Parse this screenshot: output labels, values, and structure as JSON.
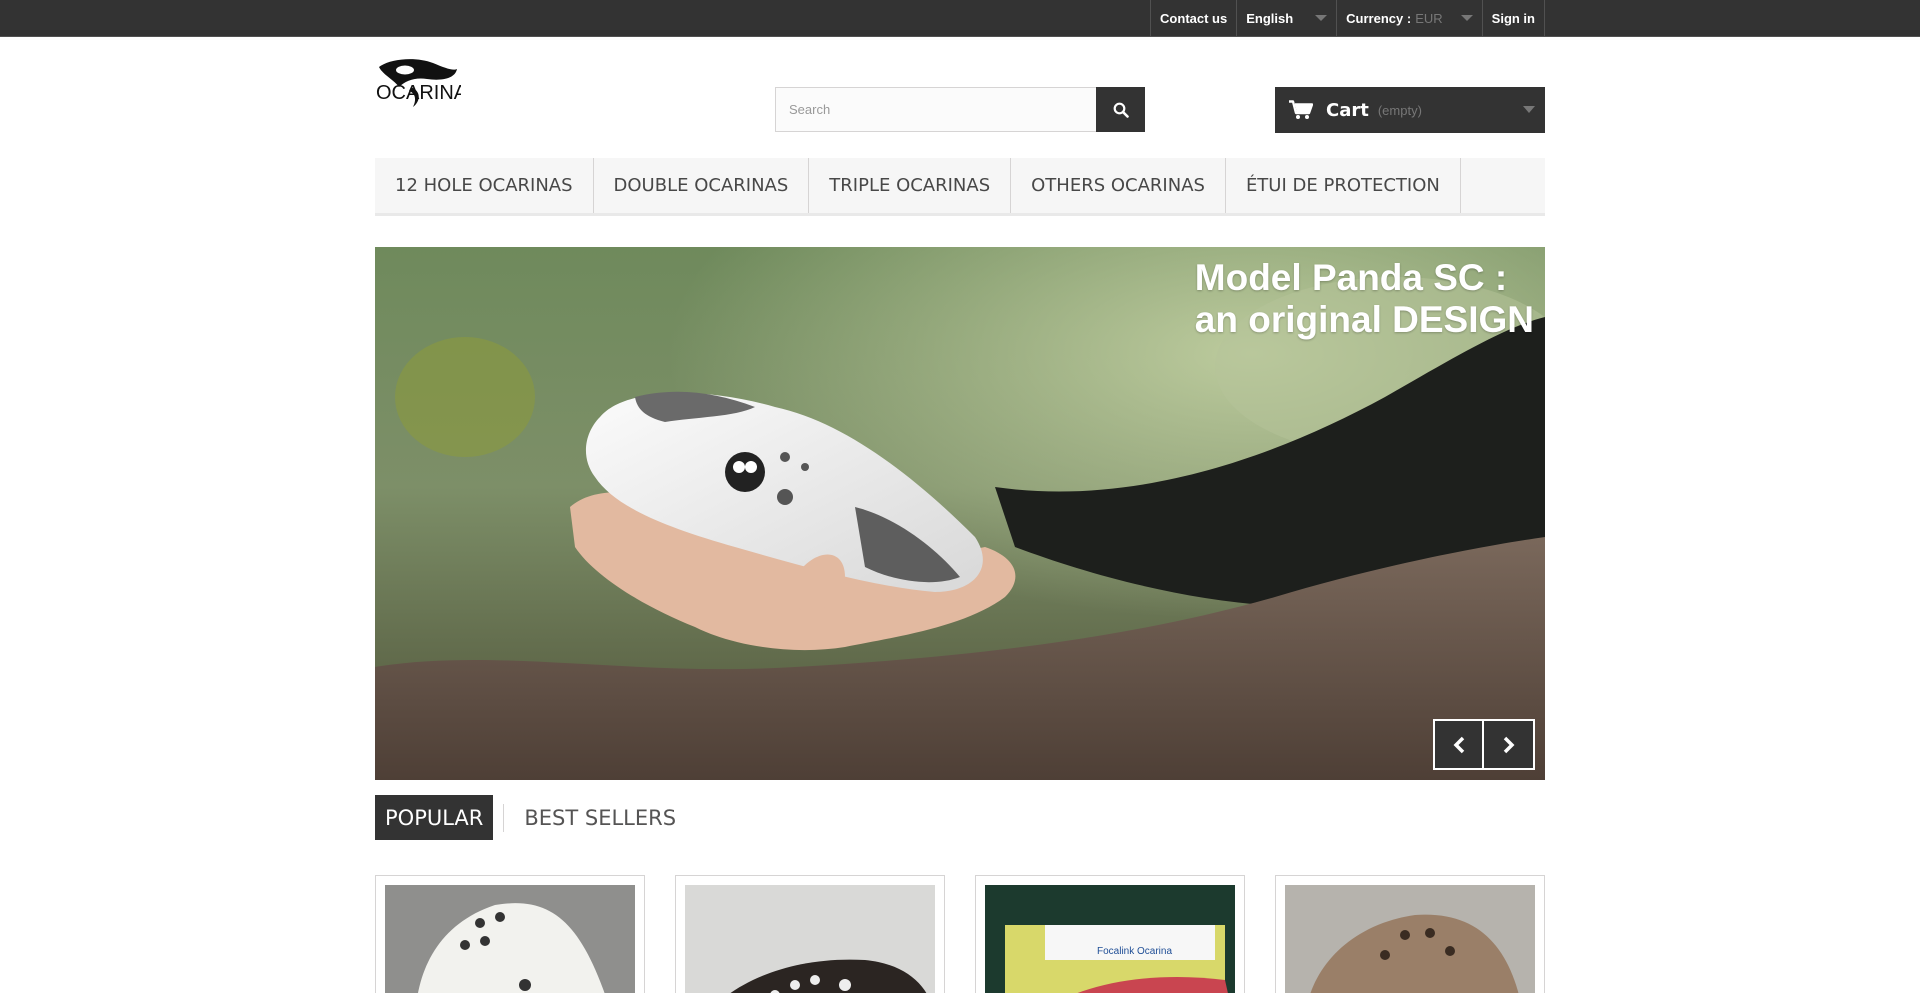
{
  "topbar": {
    "contact": "Contact us",
    "language": "English",
    "currency_label": "Currency :",
    "currency_value": "EUR",
    "signin": "Sign in"
  },
  "header": {
    "logo_text": "OCARINA",
    "search_placeholder": "Search",
    "cart_label": "Cart",
    "cart_status": "(empty)"
  },
  "menu": {
    "items": [
      "12 HOLE OCARINAS",
      "DOUBLE OCARINAS",
      "TRIPLE OCARINAS",
      "OTHERS OCARINAS",
      "ÉTUI DE PROTECTION"
    ]
  },
  "slider": {
    "caption_line1": "Model Panda SC :",
    "caption_line2": "an original DESIGN"
  },
  "tabs": {
    "items": [
      "POPULAR",
      "BEST SELLERS"
    ],
    "active": "POPULAR"
  },
  "products": {
    "box_label": "Focalink Ocarina"
  },
  "colors": {
    "dark": "#333333",
    "menu_bg": "#f6f6f6",
    "border": "#d6d4d4"
  }
}
